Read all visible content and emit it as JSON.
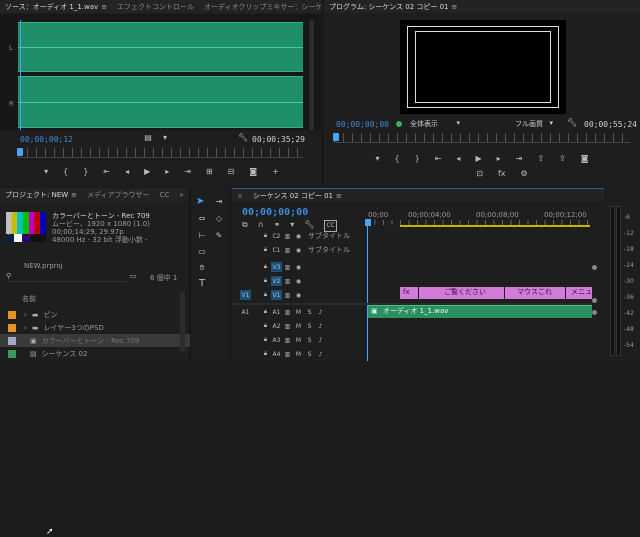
{
  "source_panel": {
    "tabs": [
      {
        "label": "ソース：オーディオ 1_1.wav",
        "active": true
      },
      {
        "label": "エフェクトコントロール",
        "active": false
      },
      {
        "label": "オーディオクリップミキサー：シーケンス",
        "active": false
      }
    ],
    "channel_labels": [
      "L",
      "R"
    ],
    "timecode_in": "00;00;00;12",
    "timecode_out": "00;00;35;29",
    "waveform_color": "#1f8f6a"
  },
  "program_panel": {
    "title": "プログラム: シーケンス 02 コピー 01",
    "timecode": "00;00;00;00",
    "view_select": "全体表示",
    "quality_select": "フル画質",
    "duration": "00;00;55;24"
  },
  "project_panel": {
    "tabs": [
      {
        "label": "プロジェクト: NEW",
        "active": true
      },
      {
        "label": "メディアブラウザー",
        "active": false
      },
      {
        "label": "CC",
        "active": false
      }
    ],
    "preview_info": {
      "name": "カラーバーとトーン - Rec 709",
      "lines": [
        "ムービー、1920 x 1080 (1.0)",
        "00;00;14;29, 29.97p",
        "48000 Hz - 32 bit 浮動小数 -"
      ]
    },
    "project_file": "NEW.prproj",
    "item_count": "6 個中 1",
    "column_header": "名前",
    "items": [
      {
        "name": "ピン",
        "type": "folder",
        "color": "#e0922b"
      },
      {
        "name": "レイヤー3つのPSD",
        "type": "folder",
        "color": "#e0922b"
      },
      {
        "name": "カラーバーとトーン - Rec 709",
        "type": "clip",
        "color": "#a6a6c8",
        "selected": true
      },
      {
        "name": "シーケンス 02",
        "type": "sequence",
        "color": "#3c9a5a"
      }
    ]
  },
  "timeline": {
    "tab": "シーケンス 02 コピー 01",
    "timecode": "00;00;00;00",
    "ruler_ticks": [
      "00;00",
      "00;00;04;00",
      "00;00;08;00",
      "00;00;12;00"
    ],
    "tracks": [
      {
        "id": "C2",
        "name": "サブタイトル",
        "kind": "caption"
      },
      {
        "id": "C1",
        "name": "サブタイトル",
        "kind": "caption"
      },
      {
        "id": "V3",
        "name": "",
        "kind": "video"
      },
      {
        "id": "V2",
        "name": "",
        "kind": "video"
      },
      {
        "id": "V1",
        "name": "",
        "kind": "video",
        "source": "V1"
      },
      {
        "id": "A1",
        "name": "",
        "kind": "audio",
        "source": "A1"
      },
      {
        "id": "A2",
        "name": "",
        "kind": "audio"
      },
      {
        "id": "A3",
        "name": "",
        "kind": "audio"
      },
      {
        "id": "A4",
        "name": "",
        "kind": "audio"
      }
    ],
    "video_clips": [
      {
        "label": "fx",
        "color": "#d27ad8"
      },
      {
        "label": "ご覧ください",
        "color": "#d27ad8"
      },
      {
        "label": "マウスこれ",
        "color": "#d27ad8"
      },
      {
        "label": "メニュ",
        "color": "#d27ad8"
      }
    ],
    "audio_clip": {
      "label": "オーディオ 1_1.wav",
      "color": "#2b8f5f"
    }
  },
  "meter": {
    "labels": [
      "-6",
      "-12",
      "-18",
      "-24",
      "-30",
      "-36",
      "-42",
      "-48",
      "-54"
    ]
  },
  "tools": [
    "select-tool",
    "track-select-tool",
    "ripple-edit-tool",
    "razor-tool",
    "slip-tool",
    "pen-tool",
    "hand-tool",
    "type-tool"
  ]
}
